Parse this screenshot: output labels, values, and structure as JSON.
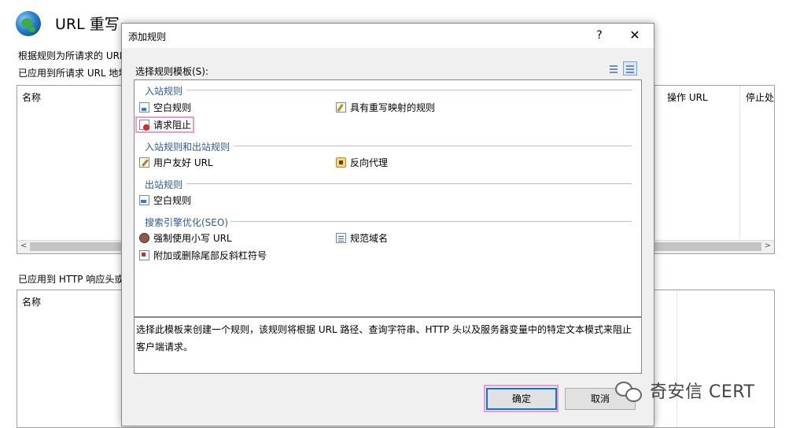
{
  "background": {
    "title": "URL 重写",
    "description_line1": "根据规则为所请求的 URL",
    "description_line2": "已应用到所请求 URL 地址",
    "table1": {
      "col_name": "名称",
      "col_action": "操作 URL",
      "col_stop": "停止处"
    },
    "section2_label": "已应用到 HTTP 响应头或",
    "table2": {
      "col_name": "名称"
    }
  },
  "dialog": {
    "title": "添加规则",
    "help_label": "?",
    "close_label": "✕",
    "select_label": "选择规则模板(S):",
    "groups": [
      {
        "header": "入站规则",
        "items": [
          {
            "label": "空白规则",
            "icon": "blank-rule-icon"
          },
          {
            "label": "具有重写映射的规则",
            "icon": "rewrite-map-icon"
          },
          {
            "label": "请求阻止",
            "icon": "request-block-icon",
            "selected": true
          }
        ]
      },
      {
        "header": "入站规则和出站规则",
        "items": [
          {
            "label": "用户友好 URL",
            "icon": "friendly-url-icon"
          },
          {
            "label": "反向代理",
            "icon": "reverse-proxy-icon"
          }
        ]
      },
      {
        "header": "出站规则",
        "items": [
          {
            "label": "空白规则",
            "icon": "outbound-blank-rule-icon"
          }
        ]
      },
      {
        "header": "搜索引擎优化(SEO)",
        "items": [
          {
            "label": "强制使用小写 URL",
            "icon": "lowercase-url-icon"
          },
          {
            "label": "规范域名",
            "icon": "canonical-domain-icon"
          },
          {
            "label": "附加或删除尾部反斜杠符号",
            "icon": "trailing-slash-icon"
          }
        ]
      }
    ],
    "description": "选择此模板来创建一个规则，该规则将根据 URL 路径、查询字符串、HTTP 头以及服务器变量中的特定文本模式来阻止客户端请求。",
    "ok_label": "确定",
    "cancel_label": "取消"
  },
  "watermark": "奇安信 CERT"
}
